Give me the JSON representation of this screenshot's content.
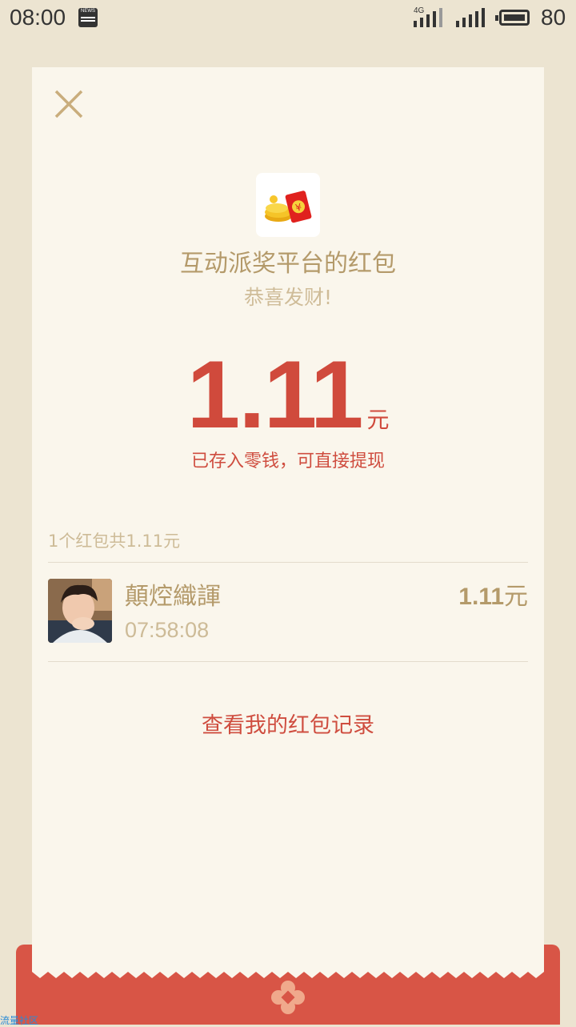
{
  "status_bar": {
    "time": "08:00",
    "notification_icon": "news-icon",
    "network_label": "4G",
    "battery_percent": "80"
  },
  "red_packet": {
    "sender": "互动派奖平台的红包",
    "wish": "恭喜发财!",
    "amount": "1.11",
    "unit": "元",
    "stored_note": "已存入零钱，可直接提现"
  },
  "summary": "1个红包共1.11元",
  "receiver": {
    "name": "顛焢織諢",
    "time": "07:58:08",
    "amount": "1.11",
    "unit": "元"
  },
  "history_link": "查看我的红包记录",
  "watermark": "流量社区",
  "colors": {
    "background": "#ece4d1",
    "card": "#faf6ec",
    "accent_red": "#d04a3c",
    "gold_text": "#b49a6a",
    "light_gold_text": "#cdbb97",
    "bottom_band": "#d85546"
  }
}
